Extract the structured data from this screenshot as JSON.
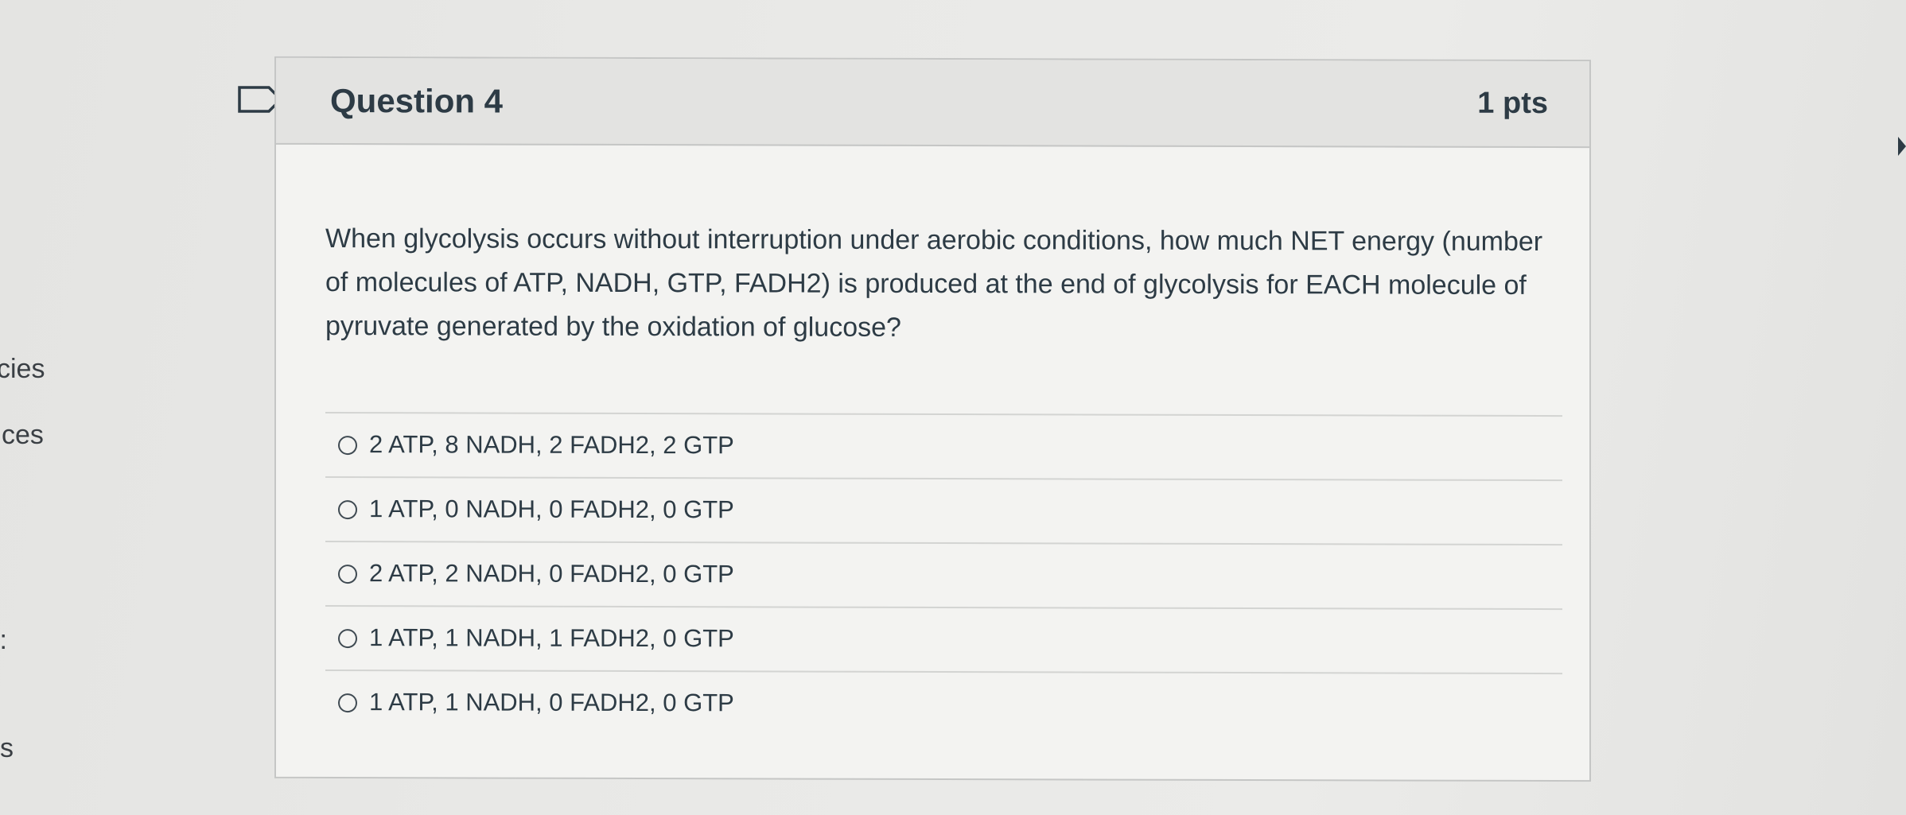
{
  "left_nav": {
    "items": [
      {
        "label": "cies"
      },
      {
        "label": "ces"
      },
      {
        "label": "l:"
      },
      {
        "label": "s"
      }
    ]
  },
  "question": {
    "title": "Question 4",
    "points": "1 pts",
    "text": "When glycolysis occurs without interruption under aerobic conditions, how much NET energy (number of molecules of ATP, NADH, GTP, FADH2) is produced at the end of glycolysis for EACH molecule of pyruvate generated by the oxidation of glucose?",
    "answers": [
      {
        "label": "2 ATP, 8 NADH, 2 FADH2, 2 GTP",
        "selected": false
      },
      {
        "label": "1 ATP, 0 NADH, 0 FADH2, 0 GTP",
        "selected": false
      },
      {
        "label": "2 ATP, 2 NADH, 0 FADH2, 0 GTP",
        "selected": false
      },
      {
        "label": "1 ATP, 1 NADH, 1 FADH2, 0 GTP",
        "selected": false
      },
      {
        "label": "1 ATP, 1 NADH, 0 FADH2, 0 GTP",
        "selected": false
      }
    ]
  },
  "icons": {
    "flag": "flag-question-icon",
    "radio": "radio-unselected-icon"
  },
  "colors": {
    "text": "#2d3b45",
    "card_background": "#f3f3f1",
    "header_background": "#e3e3e1",
    "border": "#c5c6c5"
  }
}
